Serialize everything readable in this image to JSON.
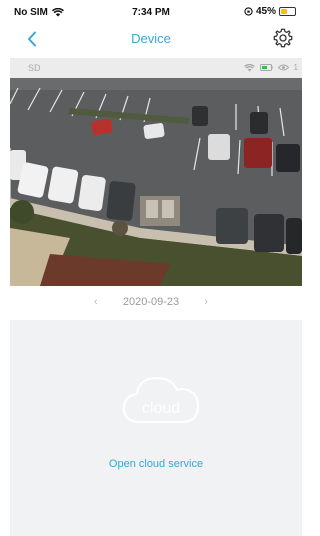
{
  "status_bar": {
    "carrier": "No SIM",
    "time": "7:34 PM",
    "battery": "45%",
    "battery_level": 0.45
  },
  "nav": {
    "title": "Device",
    "back_icon": "chevron-left-icon",
    "settings_icon": "gear-icon"
  },
  "video": {
    "quality": "SD",
    "overlay_text": "1"
  },
  "date_nav": {
    "date": "2020-09-23",
    "prev_symbol": "‹",
    "next_symbol": "›"
  },
  "cloud": {
    "icon_label": "cloud",
    "link_text": "Open cloud service"
  },
  "colors": {
    "accent": "#38a6d6"
  }
}
